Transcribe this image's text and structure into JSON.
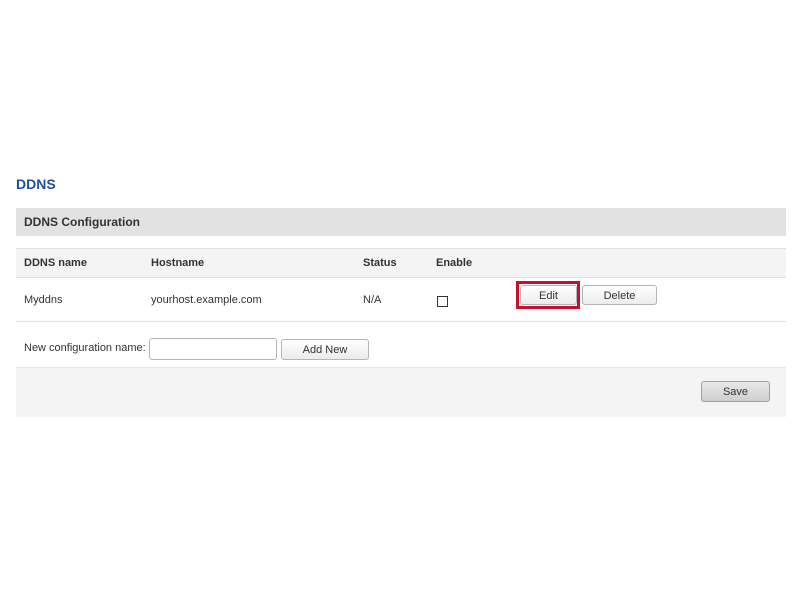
{
  "page": {
    "title": "DDNS"
  },
  "section": {
    "title": "DDNS Configuration"
  },
  "table": {
    "headers": {
      "name": "DDNS name",
      "hostname": "Hostname",
      "status": "Status",
      "enable": "Enable"
    },
    "rows": [
      {
        "name": "Myddns",
        "hostname": "yourhost.example.com",
        "status": "N/A",
        "enabled": false,
        "edit_label": "Edit",
        "delete_label": "Delete"
      }
    ]
  },
  "new_config": {
    "label": "New configuration name:",
    "value": "",
    "placeholder": "",
    "add_label": "Add New"
  },
  "footer": {
    "save_label": "Save"
  },
  "colors": {
    "title": "#1f4fa0",
    "highlight": "#c8102e",
    "section_bg": "#e2e2e2",
    "row_bg": "#f4f4f4"
  }
}
